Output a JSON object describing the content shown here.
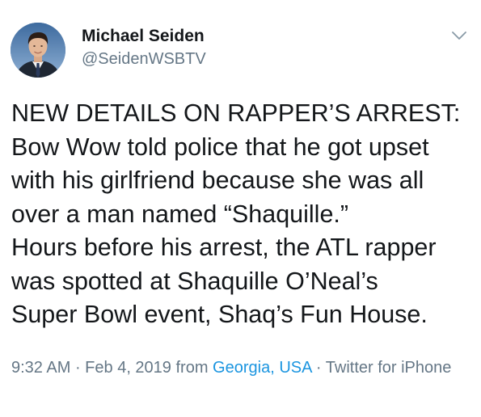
{
  "author": {
    "name": "Michael Seiden",
    "handle": "@SeidenWSBTV",
    "avatar_icon": "profile-photo"
  },
  "menu": {
    "icon": "chevron-down-icon"
  },
  "tweet": {
    "lines": [
      "NEW DETAILS ON RAPPER’S ARREST:",
      "Bow Wow told police that he got upset",
      "with his girlfriend because she was all",
      "over a man named “Shaquille.”",
      "Hours before his arrest, the ATL rapper",
      "was spotted at Shaquille O’Neal’s",
      "Super Bowl event, Shaq’s Fun House."
    ]
  },
  "meta": {
    "time": "9:32 AM",
    "separator": " · ",
    "date": "Feb 4, 2019",
    "from_label": " from ",
    "location": "Georgia, USA",
    "source": "Twitter for iPhone"
  },
  "colors": {
    "text": "#14171a",
    "secondary": "#657786",
    "link": "#1b95e0"
  }
}
